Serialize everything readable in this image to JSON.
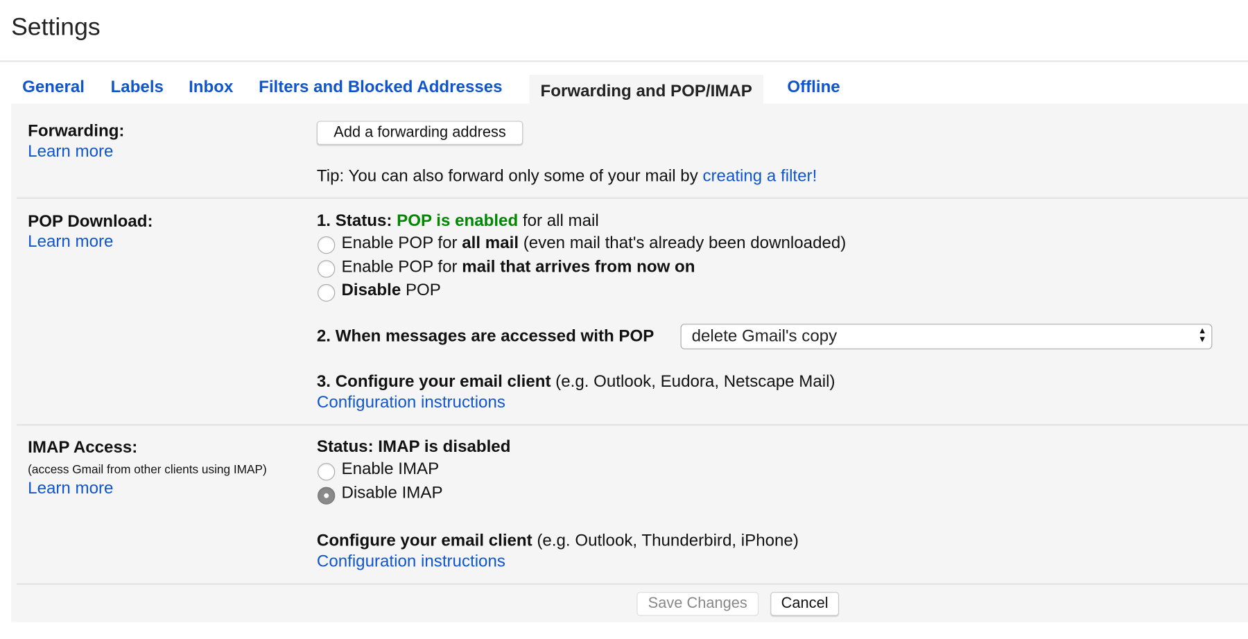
{
  "header": {
    "title": "Settings"
  },
  "tabs": [
    {
      "label": "General",
      "active": false
    },
    {
      "label": "Labels",
      "active": false
    },
    {
      "label": "Inbox",
      "active": false
    },
    {
      "label": "Filters and Blocked Addresses",
      "active": false
    },
    {
      "label": "Forwarding and POP/IMAP",
      "active": true
    },
    {
      "label": "Offline",
      "active": false
    }
  ],
  "forwarding": {
    "label": "Forwarding:",
    "learn_more": "Learn more",
    "add_button": "Add a forwarding address",
    "tip_prefix": "Tip: You can also forward only some of your mail by ",
    "tip_link": "creating a filter!"
  },
  "pop": {
    "label": "POP Download:",
    "learn_more": "Learn more",
    "status_prefix": "1. Status: ",
    "status_value": "POP is enabled",
    "status_suffix": " for all mail",
    "options": [
      {
        "pre": "Enable POP for ",
        "bold": "all mail",
        "post": " (even mail that's already been downloaded)",
        "checked": false
      },
      {
        "pre": "Enable POP for ",
        "bold": "mail that arrives from now on",
        "post": "",
        "checked": false
      },
      {
        "pre": "",
        "bold": "Disable",
        "post": " POP",
        "checked": false
      }
    ],
    "when_label": "2. When messages are accessed with POP",
    "when_value": "delete Gmail's copy",
    "configure_bold": "3. Configure your email client",
    "configure_rest": " (e.g. Outlook, Eudora, Netscape Mail)",
    "config_link": "Configuration instructions"
  },
  "imap": {
    "label": "IMAP Access:",
    "sublabel": "(access Gmail from other clients using IMAP)",
    "learn_more": "Learn more",
    "status": "Status: IMAP is disabled",
    "options": [
      {
        "label": "Enable IMAP",
        "checked": false
      },
      {
        "label": "Disable IMAP",
        "checked": true
      }
    ],
    "configure_bold": "Configure your email client",
    "configure_rest": " (e.g. Outlook, Thunderbird, iPhone)",
    "config_link": "Configuration instructions"
  },
  "footer": {
    "save": "Save Changes",
    "cancel": "Cancel"
  },
  "colors": {
    "link": "#1155cc",
    "status_green": "#008800",
    "panel": "#f5f5f5"
  }
}
